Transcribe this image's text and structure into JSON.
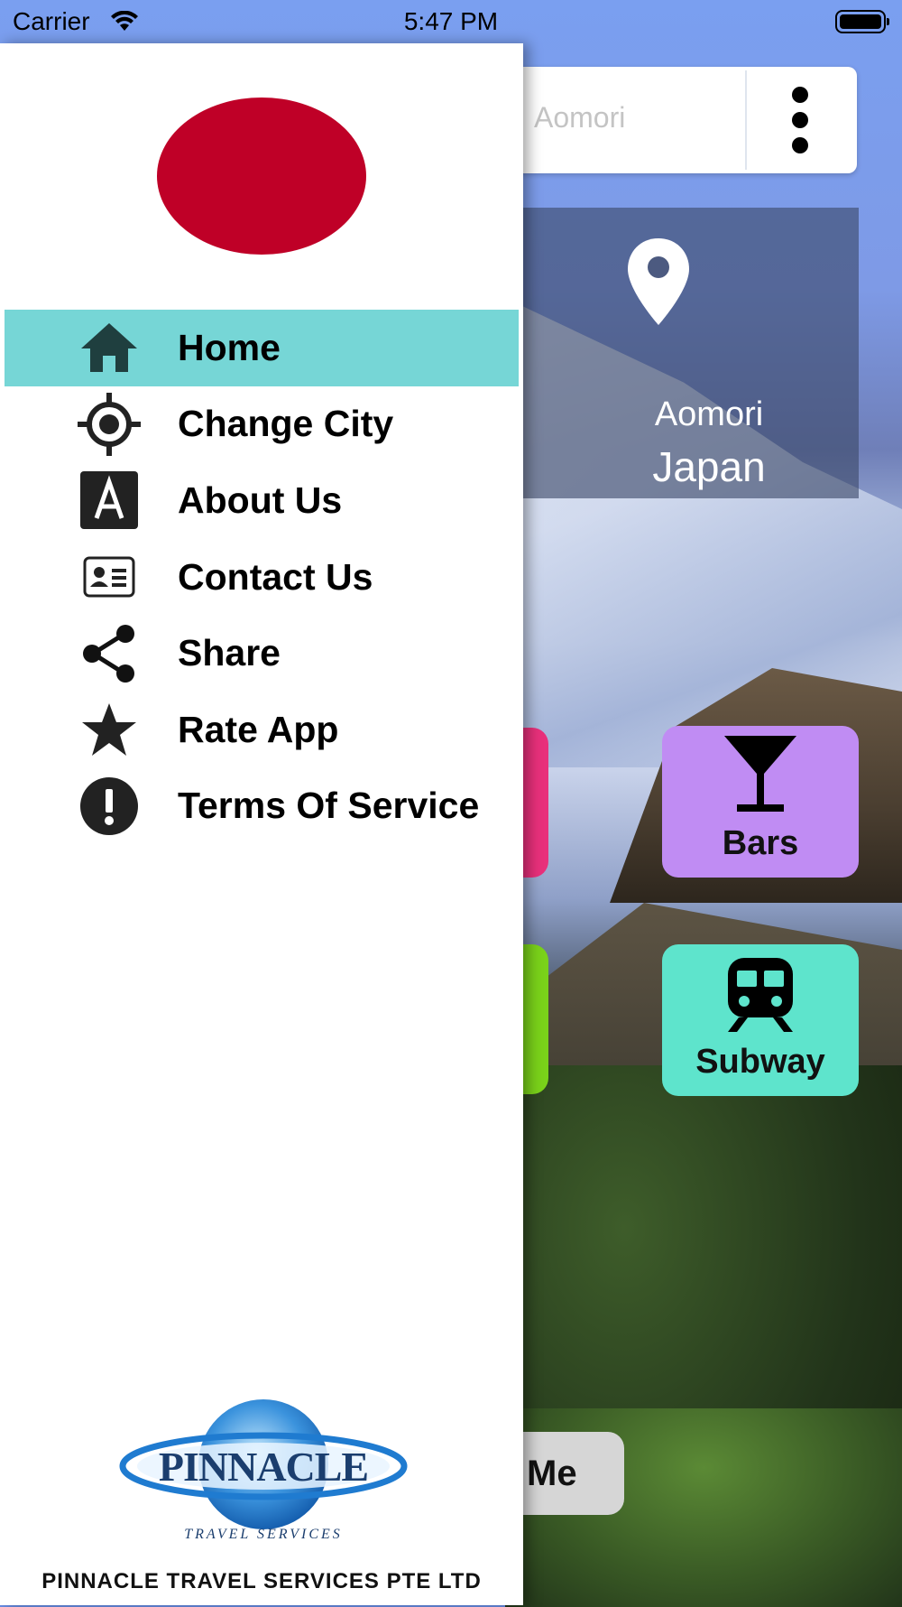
{
  "status_bar": {
    "carrier": "Carrier",
    "time": "5:47 PM"
  },
  "background_app": {
    "search": {
      "value": "Aomori"
    },
    "location": {
      "city": "Aomori",
      "country": "Japan"
    },
    "tiles": [
      {
        "label": "Bars",
        "color": "#c08cf3",
        "icon": "cocktail-icon"
      },
      {
        "label": "Subway",
        "color": "#5ee4cc",
        "icon": "train-icon"
      }
    ],
    "partial_tiles": [
      {
        "color": "#e8307b"
      },
      {
        "color": "#7ad21a"
      }
    ],
    "me_button": {
      "label": "Me"
    }
  },
  "drawer": {
    "flag": {
      "color": "#bf0027",
      "icon": "japan-flag-emblem"
    },
    "menu": [
      {
        "label": "Home",
        "icon": "home-icon",
        "active": true
      },
      {
        "label": "Change City",
        "icon": "crosshair-icon",
        "active": false
      },
      {
        "label": "About Us",
        "icon": "about-a-icon",
        "active": false
      },
      {
        "label": "Contact Us",
        "icon": "contact-card-icon",
        "active": false
      },
      {
        "label": "Share",
        "icon": "share-icon",
        "active": false
      },
      {
        "label": "Rate App",
        "icon": "star-icon",
        "active": false
      },
      {
        "label": "Terms Of Service",
        "icon": "alert-circle-icon",
        "active": false
      }
    ],
    "active_color": "#76d6d6",
    "logo": {
      "word": "PINNACLE",
      "tagline": "TRAVEL SERVICES"
    },
    "company_name": "PINNACLE TRAVEL SERVICES PTE LTD"
  }
}
